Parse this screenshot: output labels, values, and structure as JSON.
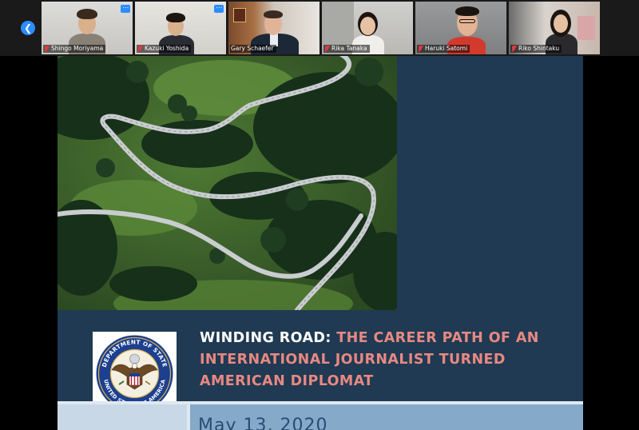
{
  "window": {
    "accent_color": "#2d8cff",
    "active_speaker_color": "#79c34a"
  },
  "participants": [
    {
      "name": "Shingo Moriyama",
      "muted": true,
      "has_more_button": true
    },
    {
      "name": "Kazuki Yoshida",
      "muted": true,
      "has_more_button": true
    },
    {
      "name": "Gary Schaefer",
      "muted": false,
      "has_more_button": false,
      "active_speaker": true
    },
    {
      "name": "Rika Tanaka",
      "muted": true,
      "has_more_button": false
    },
    {
      "name": "Haruki Satomi",
      "muted": true,
      "has_more_button": false
    },
    {
      "name": "Riko Shintaku",
      "muted": true,
      "has_more_button": false
    }
  ],
  "strip": {
    "prev_icon": "chevron-left-icon",
    "more_icon": "ellipsis-icon",
    "mute_icon": "microphone-muted-icon"
  },
  "slide": {
    "title_lead": "WINDING ROAD:",
    "title_rest": " THE CAREER PATH OF AN INTERNATIONAL JOURNALIST TURNED AMERICAN DIPLOMAT",
    "date": "May 13, 2020",
    "seal_top_text": "DEPARTMENT OF STATE",
    "seal_bottom_text": "UNITED STATES OF AMERICA",
    "background_color": "#1f3a52",
    "title_color": "#e88882",
    "title_lead_color": "#ffffff"
  }
}
